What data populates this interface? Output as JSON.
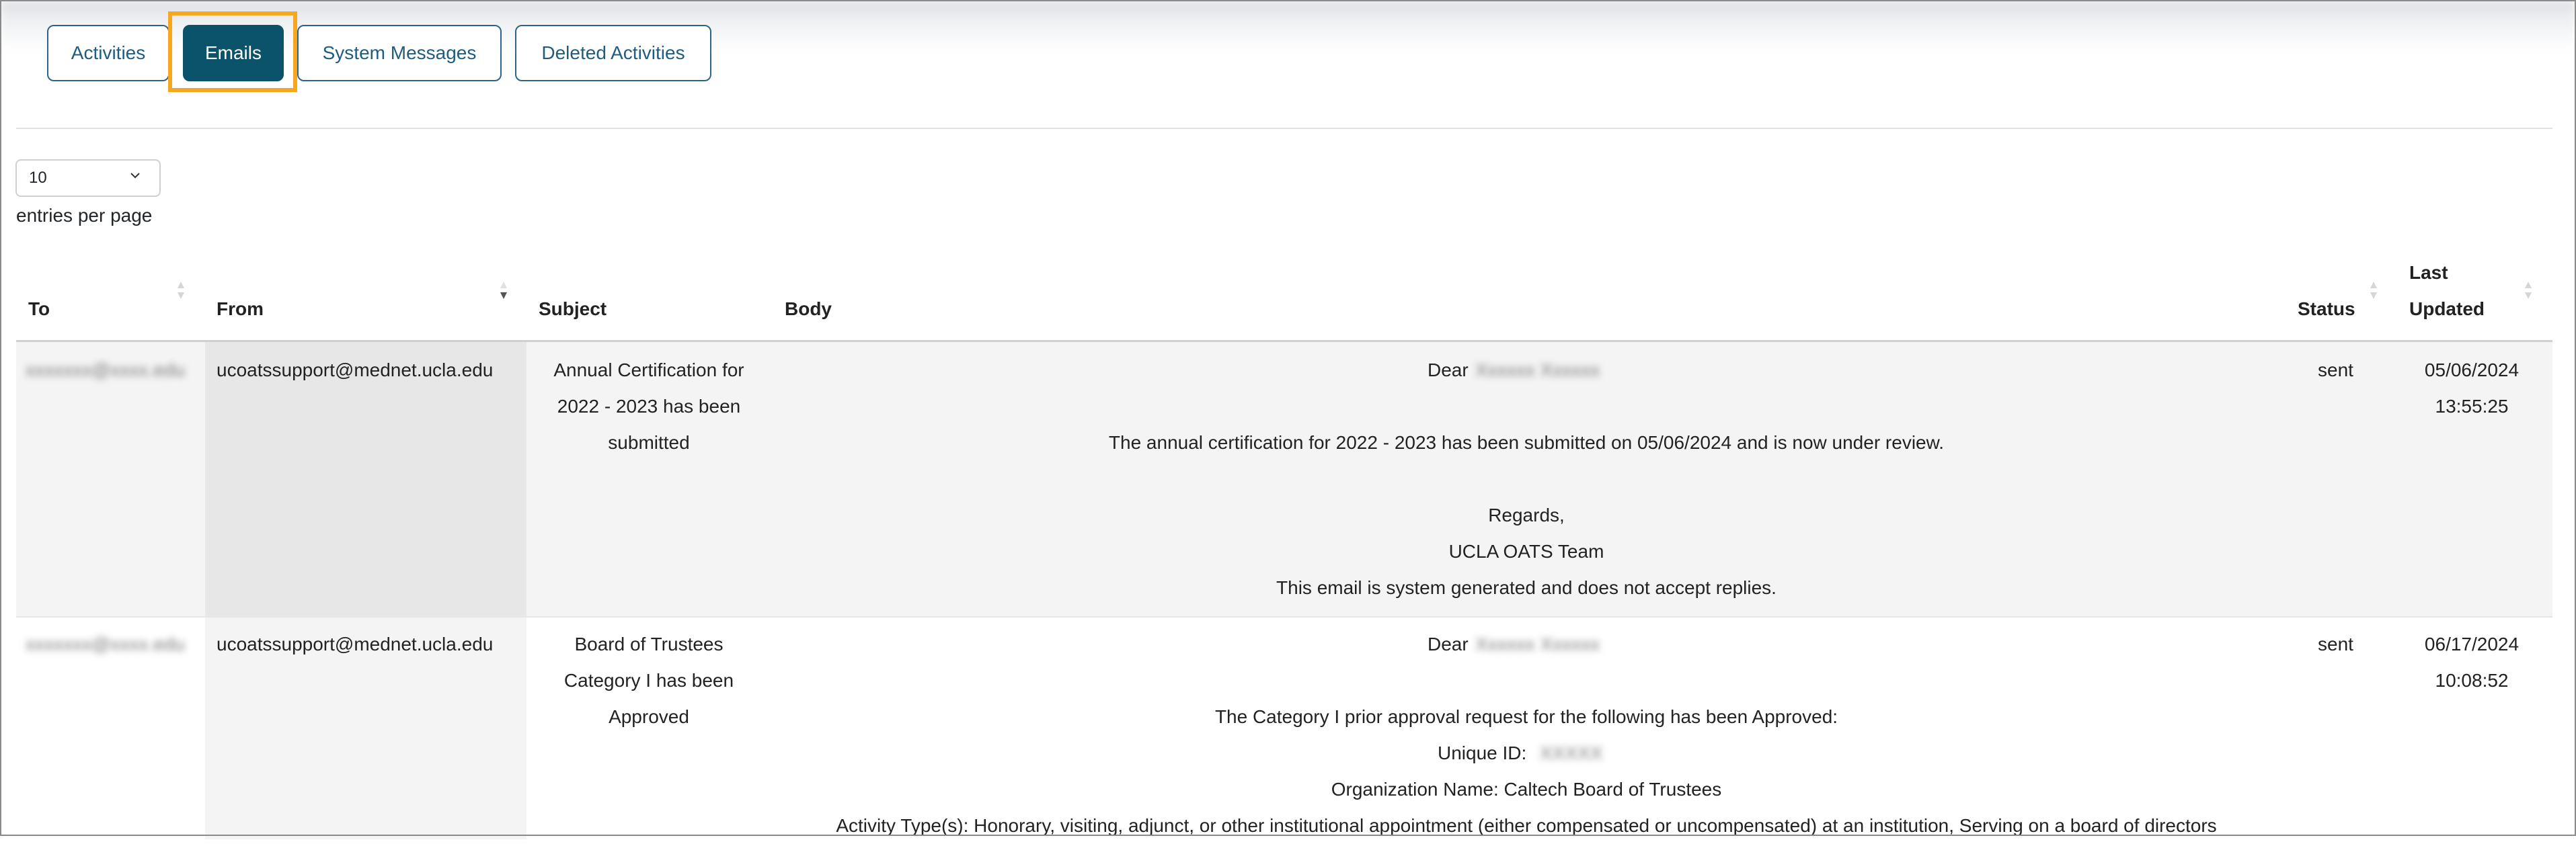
{
  "tabs": [
    {
      "label": "Activities",
      "active": false
    },
    {
      "label": "Emails",
      "active": true
    },
    {
      "label": "System Messages",
      "active": false
    },
    {
      "label": "Deleted Activities",
      "active": false
    }
  ],
  "page_size": {
    "value": "10",
    "label": "entries per page"
  },
  "columns": {
    "to": "To",
    "from": "From",
    "subject": "Subject",
    "body": "Body",
    "status": "Status",
    "last_updated_line1": "Last",
    "last_updated_line2": "Updated"
  },
  "rows": [
    {
      "to": "xxxxxxx@xxxx.edu",
      "from": "ucoatssupport@mednet.ucla.edu",
      "subject": [
        "Annual Certification for",
        "2022 - 2023 has been",
        "submitted"
      ],
      "body": {
        "greeting": "Dear",
        "name": "Xxxxxx Xxxxxx",
        "line1": "The annual certification for 2022 - 2023 has been submitted on 05/06/2024 and is now under review.",
        "regards": "Regards,",
        "team": "UCLA OATS Team",
        "footer": "This email is system generated and does not accept replies."
      },
      "status": "sent",
      "date": "05/06/2024",
      "time": "13:55:25"
    },
    {
      "to": "xxxxxxx@xxxx.edu",
      "from": "ucoatssupport@mednet.ucla.edu",
      "subject": [
        "Board of Trustees",
        "Category I has been",
        "Approved"
      ],
      "body": {
        "greeting": "Dear",
        "name": "Xxxxxx Xxxxxx",
        "line1": "The Category I prior approval request for the following has been Approved:",
        "unique_id_label": "Unique ID:",
        "unique_id_value": "XXXXX",
        "org": "Organization Name: Caltech Board of Trustees",
        "activity": "Activity Type(s): Honorary, visiting, adjunct, or other institutional appointment (either compensated or uncompensated) at an institution, Serving on a board of directors"
      },
      "status": "sent",
      "date": "06/17/2024",
      "time": "10:08:52"
    }
  ],
  "colors": {
    "accent": "#0a536b",
    "highlight": "#f5a71f",
    "tab_text": "#1f5c80"
  }
}
